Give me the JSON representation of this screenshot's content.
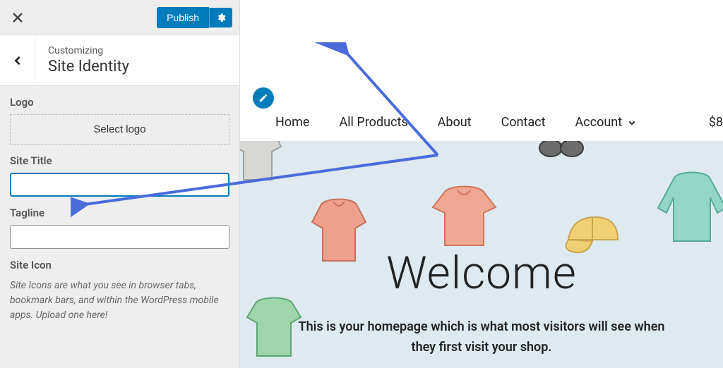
{
  "sidebar": {
    "publish_label": "Publish",
    "customizing_label": "Customizing",
    "section_title": "Site Identity",
    "fields": {
      "logo_label": "Logo",
      "select_logo_label": "Select logo",
      "site_title_label": "Site Title",
      "site_title_value": "",
      "tagline_label": "Tagline",
      "tagline_value": "",
      "site_icon_label": "Site Icon",
      "site_icon_help": "Site Icons are what you see in browser tabs, bookmark bars, and within the WordPress mobile apps. Upload one here!"
    }
  },
  "preview": {
    "nav": {
      "home": "Home",
      "all_products": "All Products",
      "about": "About",
      "contact": "Contact",
      "account": "Account",
      "cart_amount": "$8"
    },
    "hero": {
      "title": "Welcome",
      "subtitle": "This is your homepage which is what most visitors will see when they first visit your shop."
    }
  }
}
